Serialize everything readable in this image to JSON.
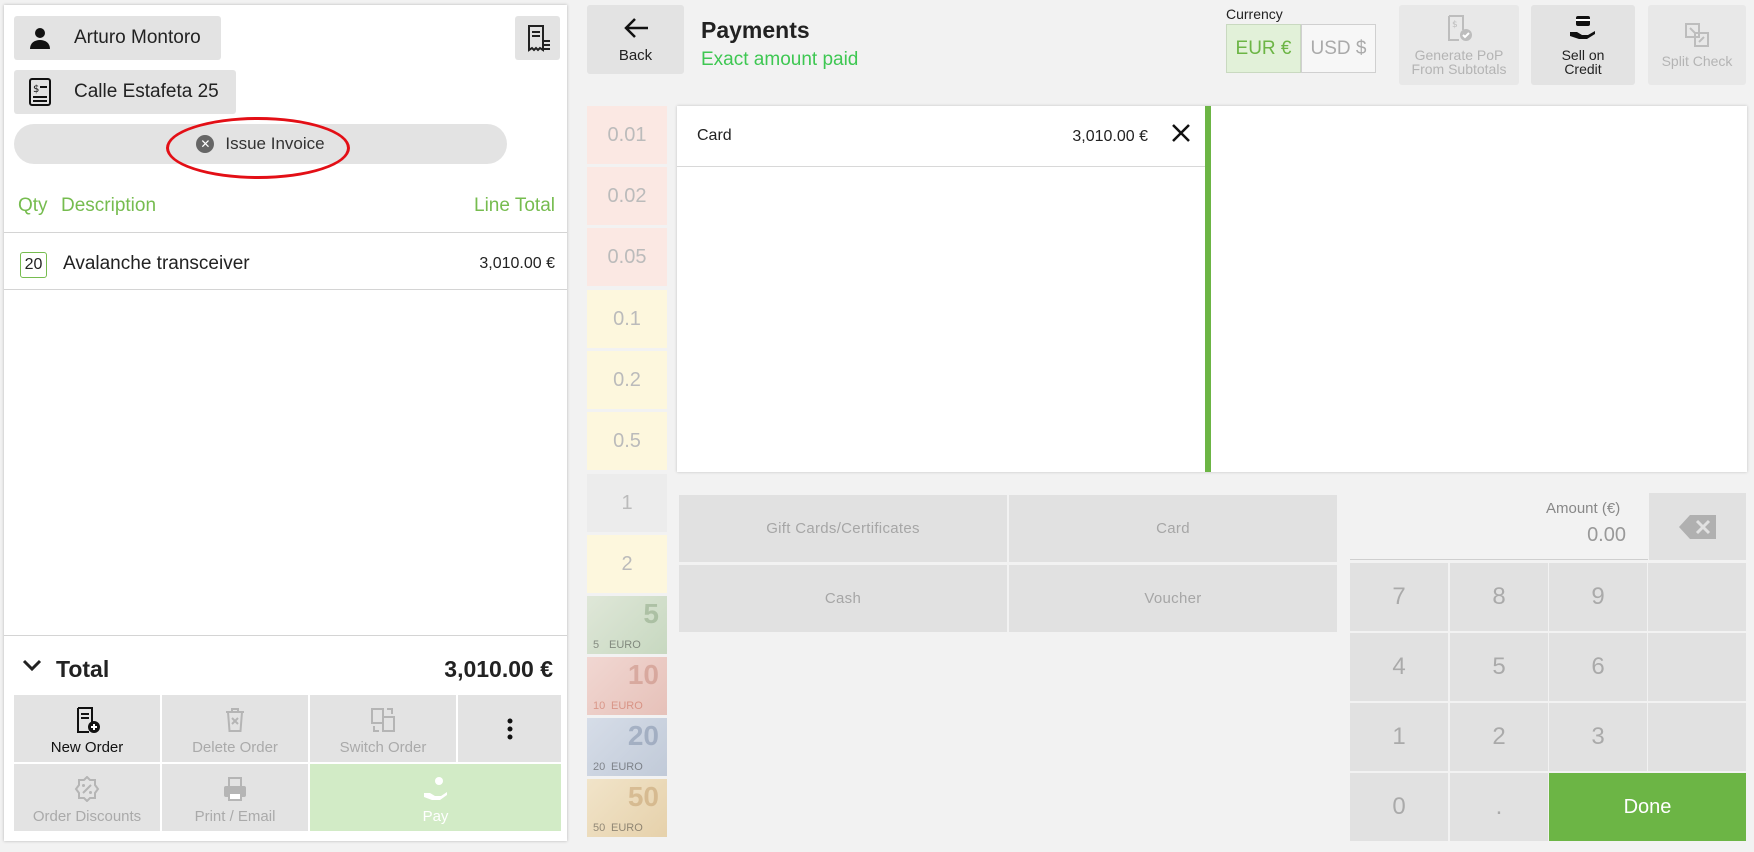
{
  "order": {
    "customer": "Arturo Montoro",
    "address": "Calle Estafeta 25",
    "issue_invoice": "Issue Invoice",
    "columns": {
      "qty": "Qty",
      "description": "Description",
      "line_total": "Line Total"
    },
    "items": [
      {
        "qty": "20",
        "description": "Avalanche transceiver",
        "line_total": "3,010.00 €"
      }
    ],
    "total_label": "Total",
    "total_value": "3,010.00 €",
    "actions": {
      "new_order": "New Order",
      "delete_order": "Delete Order",
      "switch_order": "Switch Order",
      "order_discounts": "Order Discounts",
      "print_email": "Print / Email",
      "pay": "Pay"
    }
  },
  "header": {
    "back": "Back",
    "title": "Payments",
    "subtitle": "Exact amount paid",
    "currency_label": "Currency",
    "currencies": [
      "EUR €",
      "USD $"
    ],
    "generate_pop": [
      "Generate PoP",
      "From Subtotals"
    ],
    "sell_on_credit": [
      "Sell on",
      "Credit"
    ],
    "split_check": "Split Check"
  },
  "denominations": {
    "coins": [
      "0.01",
      "0.02",
      "0.05",
      "0.1",
      "0.2",
      "0.5",
      "1",
      "2"
    ],
    "notes": [
      {
        "value": "5",
        "small": "5",
        "tag": "EURO"
      },
      {
        "value": "10",
        "small": "10",
        "tag": "EURO"
      },
      {
        "value": "20",
        "small": "20",
        "tag": "EURO"
      },
      {
        "value": "50",
        "small": "50",
        "tag": "EURO"
      }
    ]
  },
  "payments": [
    {
      "method": "Card",
      "amount": "3,010.00 €"
    }
  ],
  "tenders": {
    "gift_cards": "Gift Cards/Certificates",
    "card": "Card",
    "cash": "Cash",
    "voucher": "Voucher"
  },
  "keypad": {
    "amount_label": "Amount (€)",
    "amount_value": "0.00",
    "keys": [
      "7",
      "8",
      "9",
      "4",
      "5",
      "6",
      "1",
      "2",
      "3",
      "0",
      "."
    ],
    "done": "Done"
  },
  "colors": {
    "accent_green": "#6cb545",
    "subtitle_green": "#3ec752",
    "highlight_red": "#e30f16"
  }
}
